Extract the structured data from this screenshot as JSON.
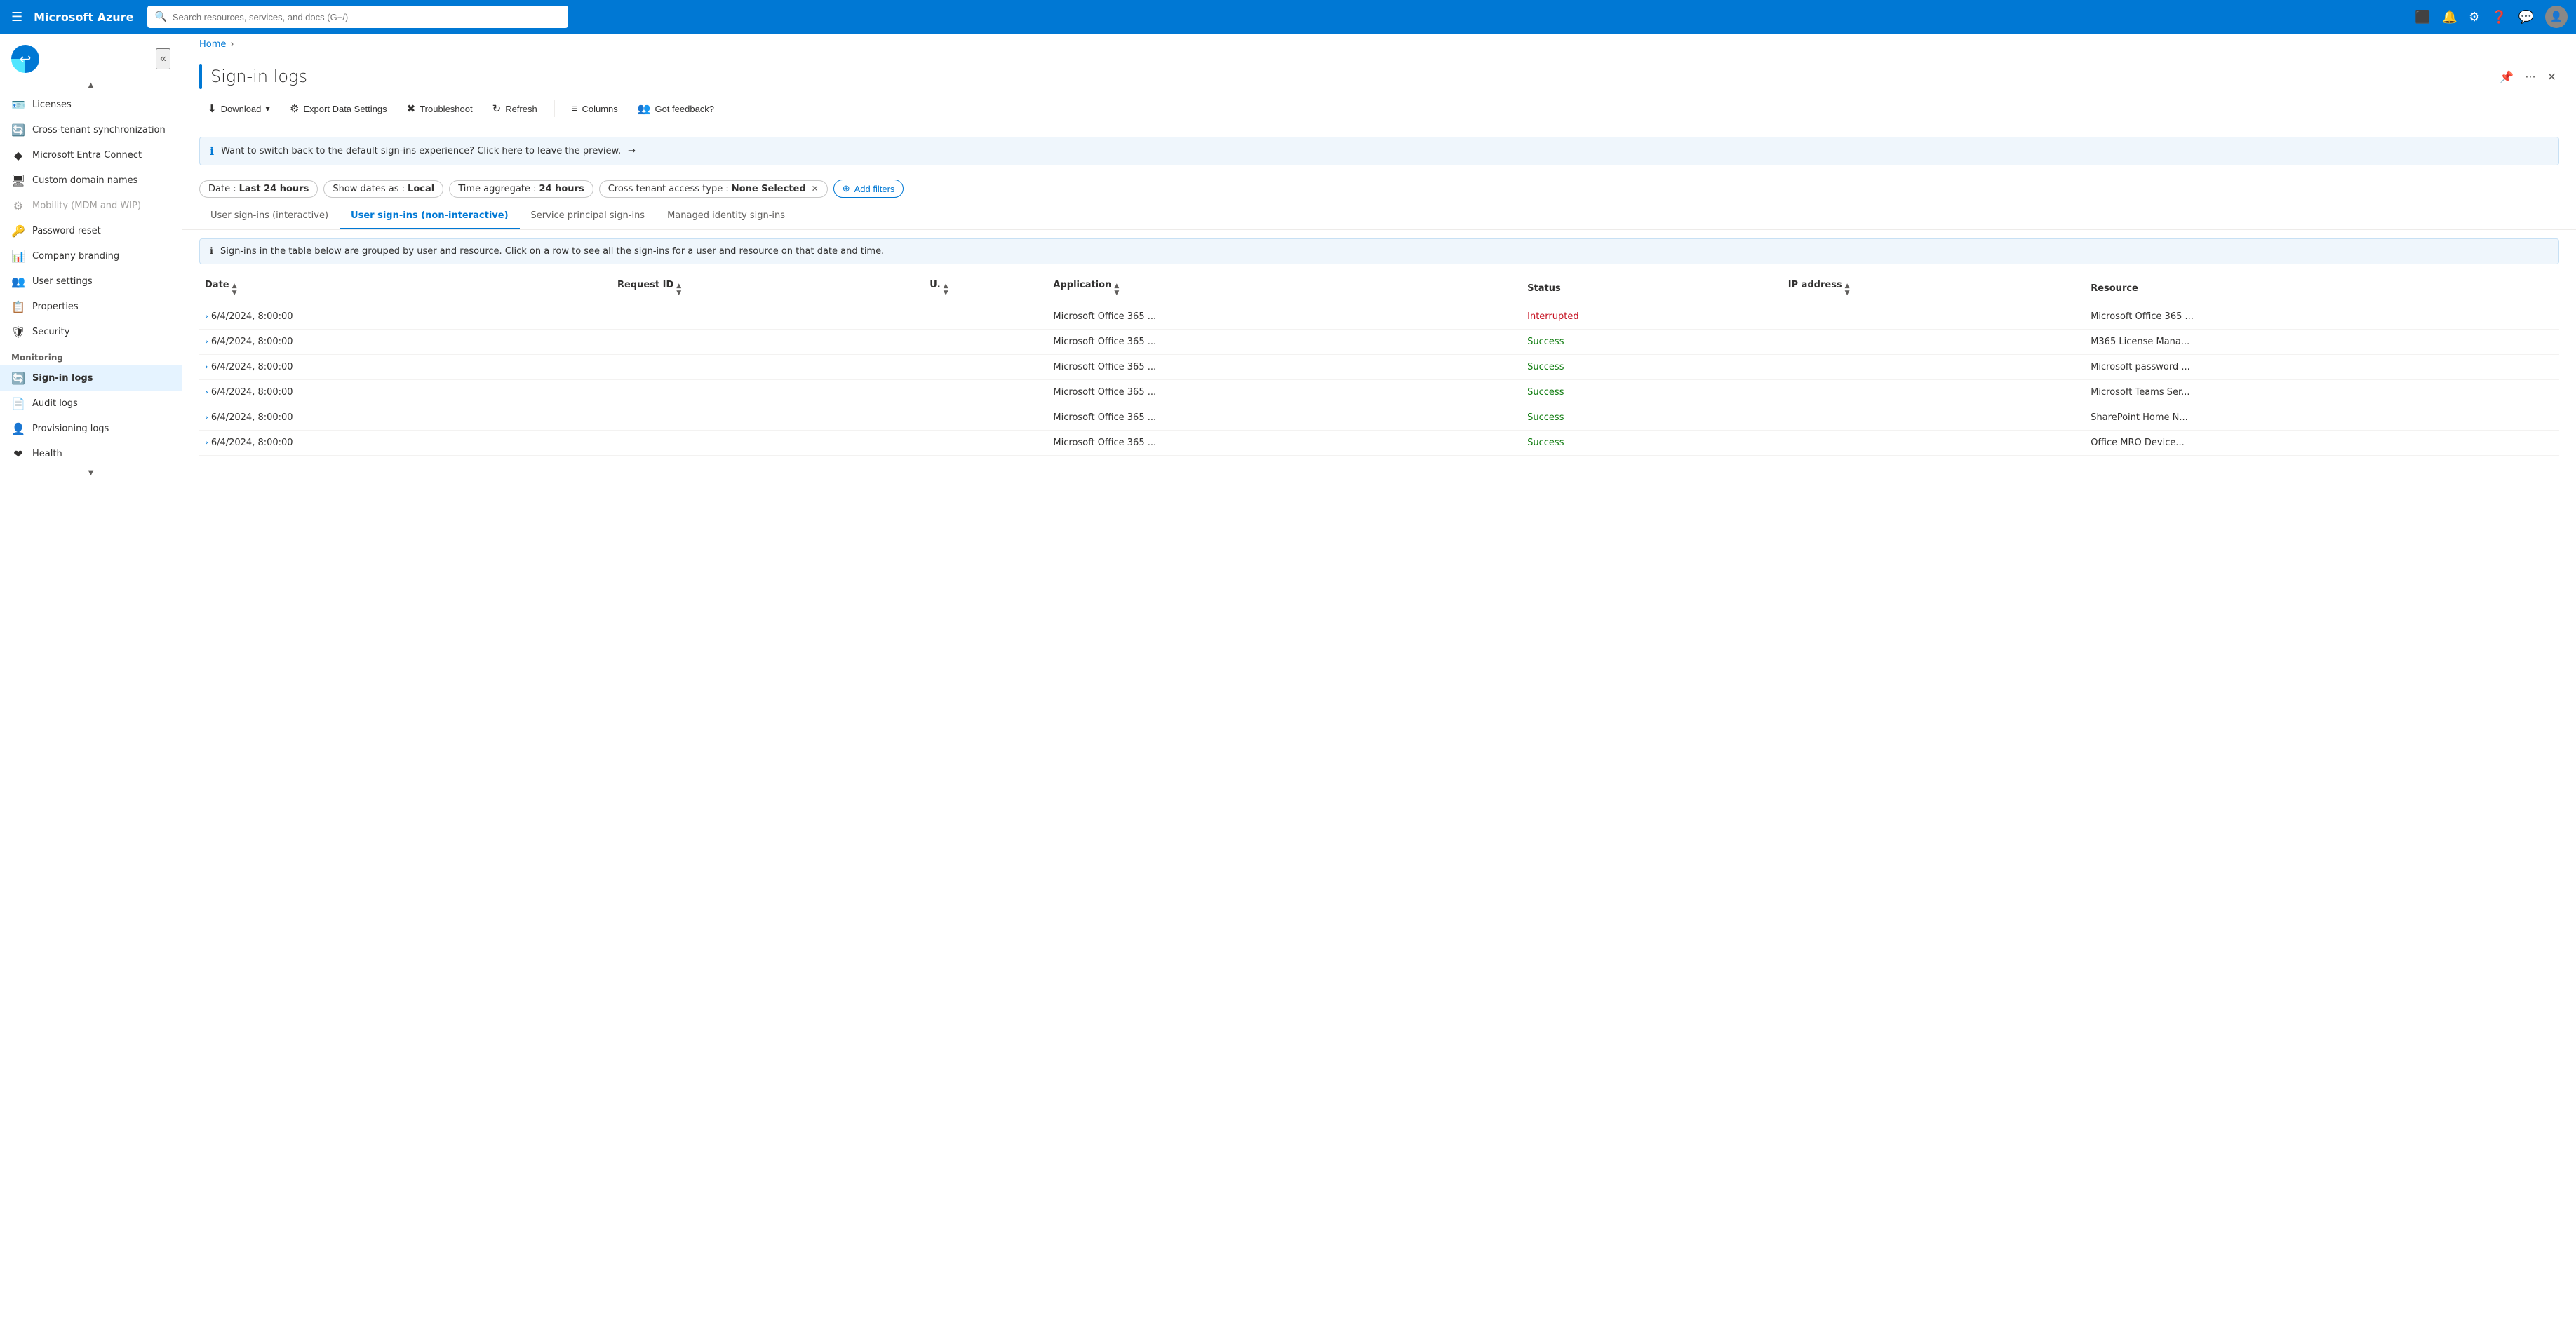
{
  "topbar": {
    "hamburger_icon": "☰",
    "title": "Microsoft Azure",
    "search_placeholder": "Search resources, services, and docs (G+/)",
    "terminal_icon": "⬜",
    "bell_icon": "🔔",
    "gear_icon": "⚙",
    "help_icon": "?",
    "feedback_icon": "👤",
    "avatar_text": "👤"
  },
  "breadcrumb": {
    "home": "Home",
    "separator": "›"
  },
  "page": {
    "title": "Sign-in logs",
    "pin_icon": "📌",
    "more_icon": "···",
    "close_icon": "✕"
  },
  "toolbar": {
    "download_label": "Download",
    "download_icon": "⬇",
    "export_label": "Export Data Settings",
    "export_icon": "⚙",
    "troubleshoot_label": "Troubleshoot",
    "troubleshoot_icon": "✕",
    "refresh_label": "Refresh",
    "refresh_icon": "↻",
    "columns_label": "Columns",
    "columns_icon": "≡",
    "feedback_label": "Got feedback?",
    "feedback_icon": "👥"
  },
  "info_banner": {
    "icon": "ℹ",
    "text": "Want to switch back to the default sign-ins experience? Click here to leave the preview.",
    "arrow": "→"
  },
  "filters": {
    "date_label": "Date :",
    "date_value": "Last 24 hours",
    "show_dates_label": "Show dates as :",
    "show_dates_value": "Local",
    "time_agg_label": "Time aggregate :",
    "time_agg_value": "24 hours",
    "cross_tenant_label": "Cross tenant access type :",
    "cross_tenant_value": "None Selected",
    "cross_tenant_close": "✕",
    "add_filter_icon": "⊕",
    "add_filter_label": "Add filters"
  },
  "tabs": [
    {
      "id": "interactive",
      "label": "User sign-ins (interactive)",
      "active": false
    },
    {
      "id": "non-interactive",
      "label": "User sign-ins (non-interactive)",
      "active": true
    },
    {
      "id": "service-principal",
      "label": "Service principal sign-ins",
      "active": false
    },
    {
      "id": "managed-identity",
      "label": "Managed identity sign-ins",
      "active": false
    }
  ],
  "table_info_banner": {
    "icon": "ℹ",
    "text": "Sign-ins in the table below are grouped by user and resource. Click on a row to see all the sign-ins for a user and resource on that date and time."
  },
  "table": {
    "columns": [
      {
        "id": "date",
        "label": "Date",
        "sortable": true
      },
      {
        "id": "request_id",
        "label": "Request ID",
        "sortable": true
      },
      {
        "id": "u",
        "label": "U.",
        "sortable": true
      },
      {
        "id": "application",
        "label": "Application",
        "sortable": true
      },
      {
        "id": "status",
        "label": "Status",
        "sortable": false
      },
      {
        "id": "ip_address",
        "label": "IP address",
        "sortable": true
      },
      {
        "id": "resource",
        "label": "Resource",
        "sortable": false
      }
    ],
    "rows": [
      {
        "expand": "›",
        "date": "6/4/2024, 8:00:00",
        "request_id": "",
        "u": "",
        "application": "Microsoft Office 365 ...",
        "status": "Interrupted",
        "status_type": "interrupted",
        "ip_address": "",
        "resource": "Microsoft Office 365 ..."
      },
      {
        "expand": "›",
        "date": "6/4/2024, 8:00:00",
        "request_id": "",
        "u": "",
        "application": "Microsoft Office 365 ...",
        "status": "Success",
        "status_type": "success",
        "ip_address": "",
        "resource": "M365 License Mana..."
      },
      {
        "expand": "›",
        "date": "6/4/2024, 8:00:00",
        "request_id": "",
        "u": "",
        "application": "Microsoft Office 365 ...",
        "status": "Success",
        "status_type": "success",
        "ip_address": "",
        "resource": "Microsoft password ..."
      },
      {
        "expand": "›",
        "date": "6/4/2024, 8:00:00",
        "request_id": "",
        "u": "",
        "application": "Microsoft Office 365 ...",
        "status": "Success",
        "status_type": "success",
        "ip_address": "",
        "resource": "Microsoft Teams Ser..."
      },
      {
        "expand": "›",
        "date": "6/4/2024, 8:00:00",
        "request_id": "",
        "u": "",
        "application": "Microsoft Office 365 ...",
        "status": "Success",
        "status_type": "success",
        "ip_address": "",
        "resource": "SharePoint Home N..."
      },
      {
        "expand": "›",
        "date": "6/4/2024, 8:00:00",
        "request_id": "",
        "u": "",
        "application": "Microsoft Office 365 ...",
        "status": "Success",
        "status_type": "success",
        "ip_address": "",
        "resource": "Office MRO Device..."
      }
    ]
  },
  "sidebar": {
    "collapse_icon": "«",
    "items_above": [
      {
        "id": "licenses",
        "icon": "🪪",
        "label": "Licenses",
        "disabled": false
      },
      {
        "id": "cross-tenant",
        "icon": "🔄",
        "label": "Cross-tenant synchronization",
        "disabled": false
      },
      {
        "id": "entra-connect",
        "icon": "◆",
        "label": "Microsoft Entra Connect",
        "disabled": false
      },
      {
        "id": "custom-domain",
        "icon": "🖥",
        "label": "Custom domain names",
        "disabled": false
      },
      {
        "id": "mobility",
        "icon": "⚙",
        "label": "Mobility (MDM and WIP)",
        "disabled": true
      },
      {
        "id": "password-reset",
        "icon": "🔑",
        "label": "Password reset",
        "disabled": false
      },
      {
        "id": "company-branding",
        "icon": "📊",
        "label": "Company branding",
        "disabled": false
      },
      {
        "id": "user-settings",
        "icon": "👥",
        "label": "User settings",
        "disabled": false
      },
      {
        "id": "properties",
        "icon": "📋",
        "label": "Properties",
        "disabled": false
      },
      {
        "id": "security",
        "icon": "🛡",
        "label": "Security",
        "disabled": false
      }
    ],
    "monitoring_section": "Monitoring",
    "monitoring_items": [
      {
        "id": "sign-in-logs",
        "icon": "🔄",
        "label": "Sign-in logs",
        "active": true
      },
      {
        "id": "audit-logs",
        "icon": "📄",
        "label": "Audit logs",
        "active": false
      },
      {
        "id": "provisioning-logs",
        "icon": "👤",
        "label": "Provisioning logs",
        "active": false
      },
      {
        "id": "health",
        "icon": "❤",
        "label": "Health",
        "active": false
      }
    ]
  }
}
